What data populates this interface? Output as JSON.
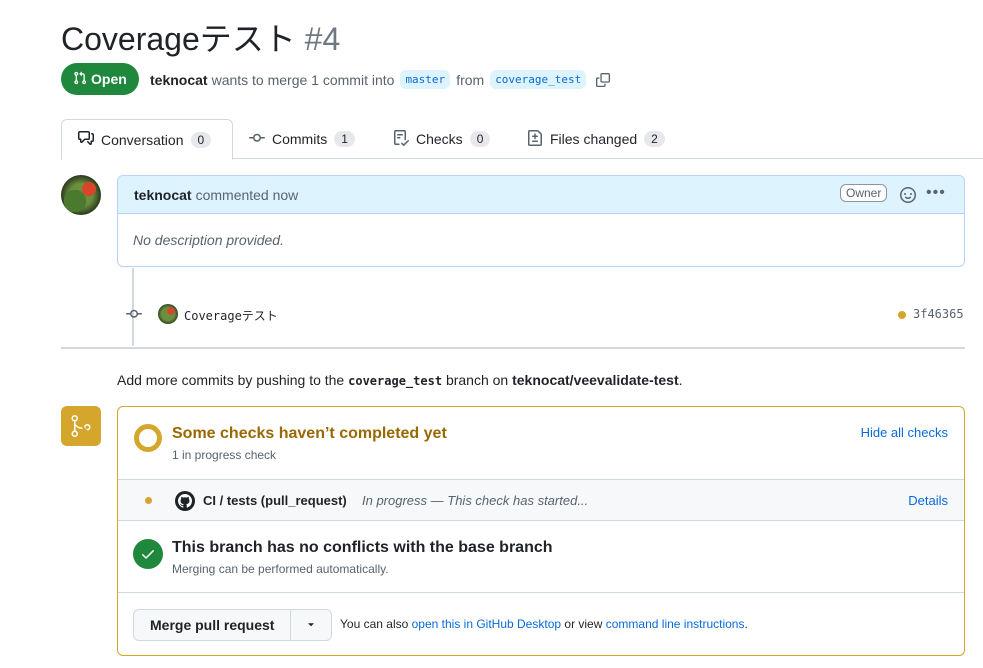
{
  "pr": {
    "title": "Coverageテスト",
    "number": "#4",
    "state": "Open",
    "author": "teknocat",
    "merge_text": "wants to merge 1 commit into",
    "base_branch": "master",
    "from_text": "from",
    "head_branch": "coverage_test"
  },
  "tabs": [
    {
      "label": "Conversation",
      "count": "0"
    },
    {
      "label": "Commits",
      "count": "1"
    },
    {
      "label": "Checks",
      "count": "0"
    },
    {
      "label": "Files changed",
      "count": "2"
    }
  ],
  "comment": {
    "author": "teknocat",
    "action": "commented now",
    "role_badge": "Owner",
    "body": "No description provided."
  },
  "commit": {
    "message": "Coverageテスト",
    "sha": "3f46365"
  },
  "push_hint": {
    "prefix": "Add more commits by pushing to the",
    "branch": "coverage_test",
    "middle": "branch on",
    "repo": "teknocat/veevalidate-test",
    "suffix": "."
  },
  "checks": {
    "title": "Some checks haven’t completed yet",
    "subtitle": "1 in progress check",
    "hide_label": "Hide all checks",
    "item_name": "CI / tests (pull_request)",
    "item_status": "In progress — This check has started...",
    "details_label": "Details"
  },
  "conflicts": {
    "title": "This branch has no conflicts with the base branch",
    "subtitle": "Merging can be performed automatically."
  },
  "merge": {
    "button_label": "Merge pull request",
    "hint_prefix": "You can also",
    "desktop_link": "open this in GitHub Desktop",
    "hint_middle": "or view",
    "cli_link": "command line instructions",
    "hint_suffix": "."
  },
  "colors": {
    "open_green": "#1f883d",
    "pending_yellow": "#d4a72c",
    "link_blue": "#0969da"
  }
}
